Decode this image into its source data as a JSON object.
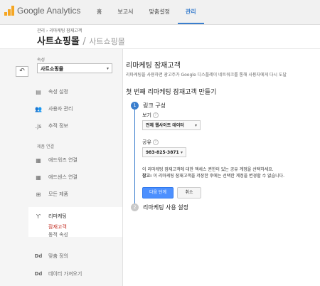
{
  "header": {
    "logo": "Google Analytics",
    "nav": [
      {
        "label": "홈",
        "active": false
      },
      {
        "label": "보고서",
        "active": false
      },
      {
        "label": "맞춤설정",
        "active": false
      },
      {
        "label": "관리",
        "active": true
      }
    ]
  },
  "breadcrumb": {
    "path": "관리 › 리마케팅 잠재고객",
    "account": "사트쇼핑몰",
    "separator": "/",
    "property": "사트쇼핑몰"
  },
  "sidebar": {
    "property_label": "속성",
    "property_select": "사트쇼핑몰",
    "items_top": [
      {
        "icon": "settings-page-icon",
        "label": "속성 설정"
      },
      {
        "icon": "users-icon",
        "label": "사용자 관리"
      },
      {
        "icon": "js-icon",
        "label": "추적 정보"
      }
    ],
    "section_label": "제품 연결",
    "items_links": [
      {
        "icon": "adwords-icon",
        "label": "애드워즈 연결"
      },
      {
        "icon": "adsense-icon",
        "label": "애드센스 연결"
      },
      {
        "icon": "all-products-icon",
        "label": "모든 제품"
      }
    ],
    "remarketing": {
      "label": "리마케팅",
      "sub_active": "잠재고객",
      "sub_other": "동적 속성"
    },
    "items_bottom": [
      {
        "icon": "dd-icon",
        "label": "맞춤 정의"
      },
      {
        "icon": "dd-icon",
        "label": "데이터 가져오기"
      }
    ]
  },
  "main": {
    "title": "리마케팅 잠재고객",
    "description": "리마케팅을 사용하면 광고주가 Google 디스플레이 네트워크를 통해 사용자에게 다시 도달",
    "subtitle": "첫 번째 리마케팅 잠재고객 만들기",
    "step1": {
      "num": "1",
      "label": "링크 구성"
    },
    "view_label": "보기",
    "view_value": "전체 웹사이트 데이터",
    "share_label": "공유",
    "share_value": "983-825-3871",
    "notice1": "이 리마케팅 잠재고객에 대한 액세스 권한이 있는 공유 계정을 선택하세요.",
    "notice2_bold": "참고:",
    "notice2": " 이 리마케팅 잠재고객을 저장한 후에는 선택한 계정을 변경할 수 없습니다.",
    "next_button": "다음 단계",
    "cancel_button": "취소",
    "step2": {
      "num": "2",
      "label": "리마케팅 사용 설정"
    }
  }
}
